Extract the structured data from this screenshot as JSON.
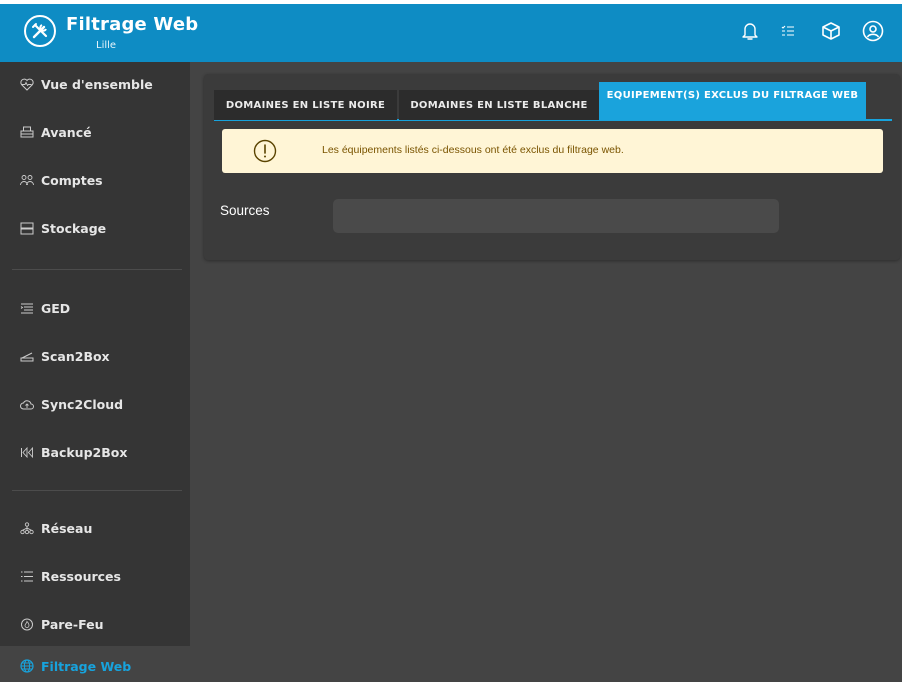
{
  "header": {
    "title": "Filtrage Web",
    "subtitle": "Lille",
    "icons": [
      "tools-icon",
      "bell-icon",
      "tasks-icon",
      "cube-icon",
      "user-circle-icon"
    ]
  },
  "sidebar": {
    "items": [
      {
        "label": "Vue d'ensemble",
        "icon": "heart-pulse-icon"
      },
      {
        "label": "Avancé",
        "icon": "printer-icon"
      },
      {
        "label": "Comptes",
        "icon": "users-icon"
      },
      {
        "label": "Stockage",
        "icon": "server-icon"
      },
      {
        "label": "GED",
        "icon": "document-list-icon"
      },
      {
        "label": "Scan2Box",
        "icon": "scanner-icon"
      },
      {
        "label": "Sync2Cloud",
        "icon": "cloud-upload-icon"
      },
      {
        "label": "Backup2Box",
        "icon": "rewind-icon"
      },
      {
        "label": "Réseau",
        "icon": "network-icon"
      },
      {
        "label": "Ressources",
        "icon": "list-icon"
      },
      {
        "label": "Pare-Feu",
        "icon": "firewall-icon"
      }
    ],
    "active": {
      "label": "Filtrage Web",
      "icon": "globe-icon"
    }
  },
  "tabs": [
    {
      "label": "DOMAINES EN LISTE NOIRE",
      "active": false
    },
    {
      "label": "DOMAINES EN LISTE BLANCHE",
      "active": false
    },
    {
      "label": "EQUIPEMENT(S) EXCLUS DU FILTRAGE WEB",
      "active": true
    }
  ],
  "alert": {
    "text": "Les équipements listés ci-dessous ont été exclus du filtrage web.",
    "icon": "warning-circle-icon"
  },
  "sources": {
    "label": "Sources",
    "value": ""
  },
  "colors": {
    "accent": "#17a3dd",
    "header": "#0e8cc4",
    "background": "#444444",
    "sidebar": "#353535",
    "alert_bg": "#fff5d6",
    "alert_text": "#7a5400"
  }
}
